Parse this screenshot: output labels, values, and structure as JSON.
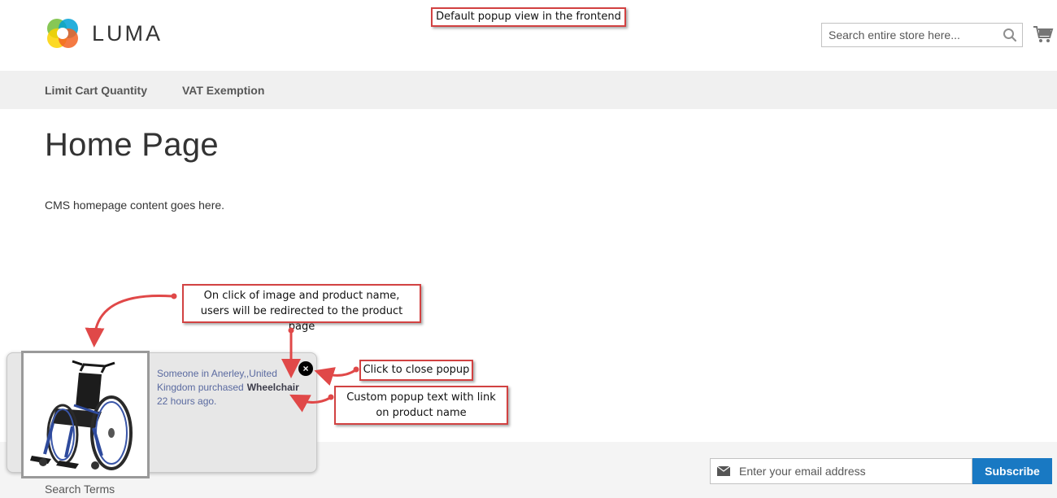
{
  "header": {
    "logo_text": "LUMA",
    "search_placeholder": "Search entire store here...",
    "cart_icon": "cart-icon"
  },
  "nav": {
    "items": [
      {
        "label": "Limit Cart Quantity"
      },
      {
        "label": "VAT Exemption"
      }
    ]
  },
  "main": {
    "title": "Home Page",
    "content": "CMS homepage content goes here."
  },
  "popup": {
    "text_before": "Someone in Anerley,,United Kingdom purchased",
    "product_name": "Wheelchair",
    "text_after": "22 hours ago.",
    "close_label": "×"
  },
  "footer": {
    "search_terms": "Search Terms",
    "newsletter_placeholder": "Enter your email address",
    "subscribe_label": "Subscribe"
  },
  "annotations": {
    "top": "Default popup view in the frontend",
    "redirect": "On click of image and product name, users will be redirected to the product page",
    "close": "Click to close popup",
    "custom_text": "Custom popup text with link on product name"
  },
  "colors": {
    "accent": "#1979c3",
    "annotation_border": "#d24242",
    "nav_bg": "#f0f0f0"
  }
}
